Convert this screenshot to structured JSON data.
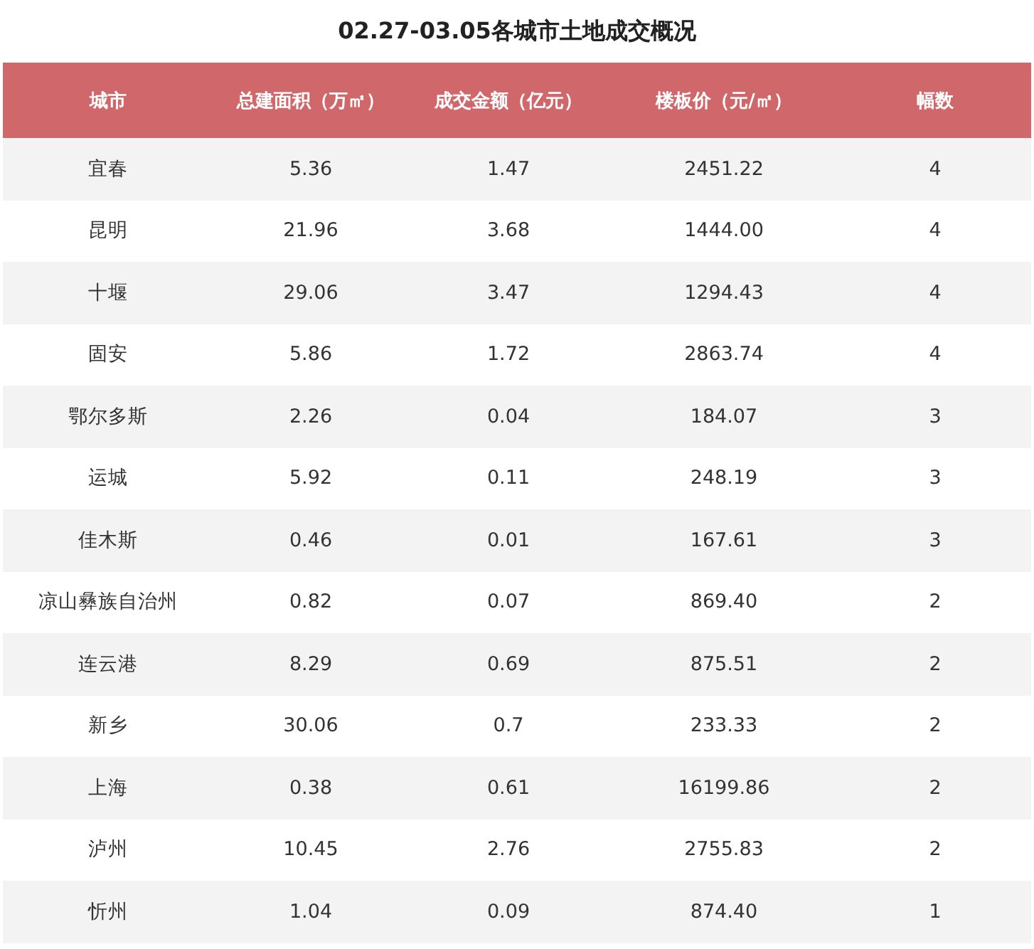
{
  "title": "02.27-03.05各城市土地成交概况",
  "table": {
    "columns": [
      "城市",
      "总建面积（万㎡）",
      "成交金额（亿元）",
      "楼板价（元/㎡）",
      "幅数"
    ],
    "rows": [
      [
        "宜春",
        "5.36",
        "1.47",
        "2451.22",
        "4"
      ],
      [
        "昆明",
        "21.96",
        "3.68",
        "1444.00",
        "4"
      ],
      [
        "十堰",
        "29.06",
        "3.47",
        "1294.43",
        "4"
      ],
      [
        "固安",
        "5.86",
        "1.72",
        "2863.74",
        "4"
      ],
      [
        "鄂尔多斯",
        "2.26",
        "0.04",
        "184.07",
        "3"
      ],
      [
        "运城",
        "5.92",
        "0.11",
        "248.19",
        "3"
      ],
      [
        "佳木斯",
        "0.46",
        "0.01",
        "167.61",
        "3"
      ],
      [
        "凉山彝族自治州",
        "0.82",
        "0.07",
        "869.40",
        "2"
      ],
      [
        "连云港",
        "8.29",
        "0.69",
        "875.51",
        "2"
      ],
      [
        "新乡",
        "30.06",
        "0.7",
        "233.33",
        "2"
      ],
      [
        "上海",
        "0.38",
        "0.61",
        "16199.86",
        "2"
      ],
      [
        "泸州",
        "10.45",
        "2.76",
        "2755.83",
        "2"
      ],
      [
        "忻州",
        "1.04",
        "0.09",
        "874.40",
        "1"
      ]
    ]
  }
}
